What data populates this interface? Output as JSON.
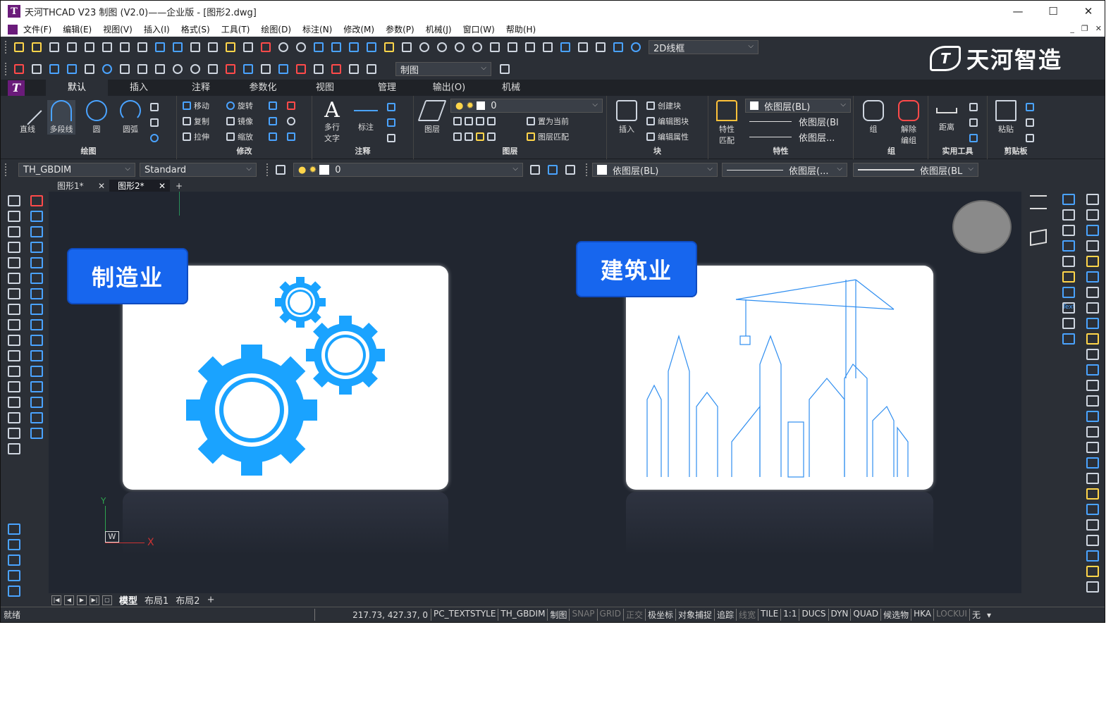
{
  "window": {
    "title": "天河THCAD V23 制图 (V2.0)——企业版 - [图形2.dwg]",
    "app_icon": "T",
    "controls": [
      "—",
      "☐",
      "✕"
    ],
    "mdi_controls": [
      "_",
      "❐",
      "✕"
    ]
  },
  "menu": [
    "文件(F)",
    "编辑(E)",
    "视图(V)",
    "插入(I)",
    "格式(S)",
    "工具(T)",
    "绘图(D)",
    "标注(N)",
    "修改(M)",
    "参数(P)",
    "机械(J)",
    "窗口(W)",
    "帮助(H)"
  ],
  "toolbar": {
    "visual_style": "2D线框",
    "workspace": "制图"
  },
  "brand": {
    "mark": "T",
    "name": "天河智造"
  },
  "ribbon_tabs": [
    "默认",
    "插入",
    "注释",
    "参数化",
    "视图",
    "管理",
    "输出(O)",
    "机械"
  ],
  "ribbon": {
    "draw": {
      "title": "绘图",
      "line": "直线",
      "polyline": "多段线",
      "circle": "圆",
      "arc": "圆弧"
    },
    "modify": {
      "title": "修改",
      "move": "移动",
      "rotate": "旋转",
      "copy": "复制",
      "mirror": "镜像",
      "stretch": "拉伸",
      "scale": "缩放"
    },
    "annotation": {
      "title": "注释",
      "mtext_1": "多行",
      "mtext_2": "文字",
      "dimension": "标注"
    },
    "layers": {
      "title": "图层",
      "layer_props": "图层",
      "current_layer": "0",
      "set_current": "置为当前",
      "match_layer": "图层匹配"
    },
    "block": {
      "title": "块",
      "insert": "插入",
      "create": "创建块",
      "edit_block": "编辑图块",
      "edit_attr": "编辑属性"
    },
    "properties": {
      "title": "特性",
      "match_1": "特性",
      "match_2": "匹配",
      "color": "依图层(BL)",
      "linetype": "依图层(Bl",
      "lineweight": "依图层..."
    },
    "groups": {
      "title": "组",
      "group": "组",
      "ungroup_1": "解除",
      "ungroup_2": "编组"
    },
    "utilities": {
      "title": "实用工具",
      "measure": "距离"
    },
    "clipboard": {
      "title": "剪贴板",
      "paste": "粘贴"
    }
  },
  "propbar": {
    "dim_style": "TH_GBDIM",
    "text_style": "Standard",
    "layer": "0",
    "color": "依图层(BL)",
    "linetype": "依图层(...",
    "lineweight": "依图层(BL"
  },
  "doc_tabs": [
    {
      "label": "图形1*",
      "close": "✕"
    },
    {
      "label": "图形2*",
      "close": "✕"
    }
  ],
  "doc_tab_add": "+",
  "canvas": {
    "card_left_label": "制造业",
    "card_right_label": "建筑业",
    "ucs_y": "Y",
    "ucs_x": "X",
    "ucs_w": "W"
  },
  "right_palette": {
    "text_label": "Text"
  },
  "layout_tabs": [
    "模型",
    "布局1",
    "布局2"
  ],
  "layout_add": "+",
  "status": {
    "ready": "就绪",
    "coords": "217.73, 427.37, 0",
    "items": [
      {
        "label": "PC_TEXTSTYLE",
        "on": true
      },
      {
        "label": "TH_GBDIM",
        "on": true
      },
      {
        "label": "制图",
        "on": true
      },
      {
        "label": "SNAP",
        "on": false
      },
      {
        "label": "GRID",
        "on": false
      },
      {
        "label": "正交",
        "on": false
      },
      {
        "label": "极坐标",
        "on": true
      },
      {
        "label": "对象捕捉",
        "on": true
      },
      {
        "label": "追踪",
        "on": true
      },
      {
        "label": "线宽",
        "on": false
      },
      {
        "label": "TILE",
        "on": true
      },
      {
        "label": "1:1",
        "on": true
      },
      {
        "label": "DUCS",
        "on": true
      },
      {
        "label": "DYN",
        "on": true
      },
      {
        "label": "QUAD",
        "on": true
      },
      {
        "label": "候选物",
        "on": true
      },
      {
        "label": "HKA",
        "on": true
      },
      {
        "label": "LOCKUI",
        "on": false
      },
      {
        "label": "无",
        "on": true
      }
    ]
  },
  "colors": {
    "accent_blue": "#1aa3ff",
    "badge_blue": "#1766ee",
    "canvas_bg": "#212630",
    "ui_bg": "#2b2f36"
  }
}
